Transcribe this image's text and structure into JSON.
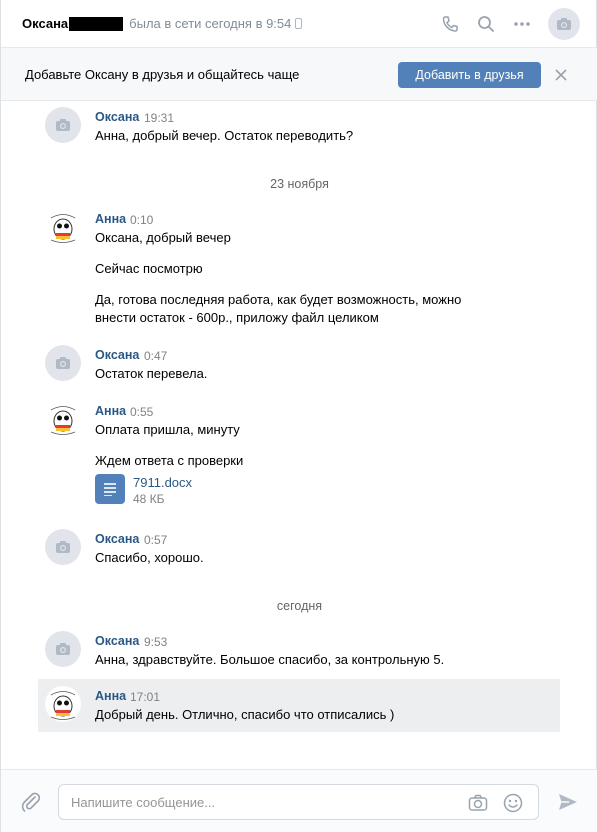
{
  "header": {
    "name": "Оксана",
    "status": "была в сети сегодня в 9:54",
    "icons": [
      "phone-icon",
      "search-icon",
      "more-icon",
      "camera-icon"
    ]
  },
  "banner": {
    "text": "Добавьте Оксану в друзья и общайтесь чаще",
    "button": "Добавить в друзья"
  },
  "messages": [
    {
      "author": "Оксана",
      "time": "19:31",
      "lines": [
        "Анна, добрый вечер. Остаток переводить?"
      ]
    },
    {
      "divider": "23 ноября"
    },
    {
      "author": "Анна",
      "time": "0:10",
      "lines": [
        "Оксана, добрый вечер",
        "Сейчас посмотрю",
        "Да, готова последняя работа, как будет возможность, можно",
        "внести остаток - 600р., приложу файл целиком"
      ]
    },
    {
      "author": "Оксана",
      "time": "0:47",
      "lines": [
        "Остаток перевела."
      ]
    },
    {
      "author": "Анна",
      "time": "0:55",
      "lines": [
        "Оплата пришла, минуту",
        "Ждем ответа с проверки"
      ],
      "file": {
        "name": "7911.docx",
        "size": "48 КБ"
      }
    },
    {
      "author": "Оксана",
      "time": "0:57",
      "lines": [
        "Спасибо, хорошо."
      ]
    },
    {
      "divider": "сегодня"
    },
    {
      "author": "Оксана",
      "time": "9:53",
      "lines": [
        "Анна, здравствуйте. Большое спасибо, за контрольную 5."
      ]
    },
    {
      "author": "Анна",
      "time": "17:01",
      "lines": [
        "Добрый день. Отлично, спасибо что отписались )"
      ]
    }
  ],
  "composer": {
    "placeholder": "Напишите сообщение..."
  },
  "colors": {
    "accent": "#5181b8",
    "author_link": "#2a5885",
    "highlight": "#edeef0"
  }
}
